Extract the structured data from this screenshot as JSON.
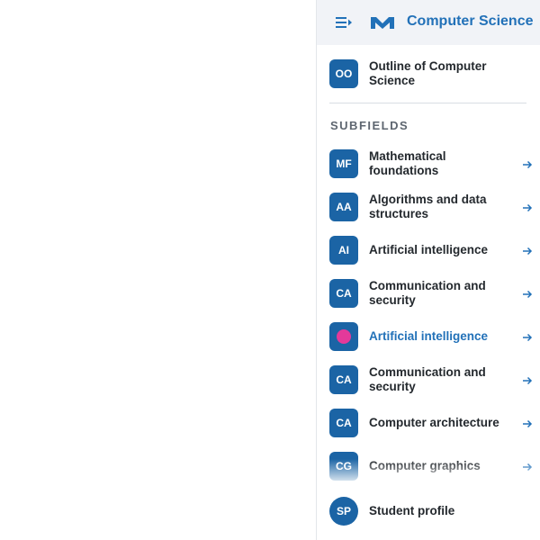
{
  "header": {
    "title": "Computer Science",
    "menu_icon": "collapse-menu-icon",
    "logo_icon": "brand-m-logo-icon"
  },
  "outline": {
    "initials": "OO",
    "label": "Outline of Computer Science"
  },
  "subfields": {
    "title": "SUBFIELDS",
    "items": [
      {
        "initials": "MF",
        "label": "Mathematical foundations",
        "active": false
      },
      {
        "initials": "AA",
        "label": "Algorithms and data structures",
        "active": false
      },
      {
        "initials": "AI",
        "label": "Artificial intelligence",
        "active": false
      },
      {
        "initials": "CA",
        "label": "Communication and security",
        "active": false
      },
      {
        "initials": "",
        "label": "Artificial intelligence",
        "active": true
      },
      {
        "initials": "CA",
        "label": "Communication and security",
        "active": false
      },
      {
        "initials": "CA",
        "label": "Computer architecture",
        "active": false
      },
      {
        "initials": "CG",
        "label": "Computer graphics",
        "active": false
      }
    ],
    "arrow_icon": "arrow-right-icon"
  },
  "profile": {
    "initials": "SP",
    "label": "Student profile"
  },
  "colors": {
    "accent": "#2271b8",
    "avatar": "#1b64a5",
    "active_dot": "#e4399a",
    "header_bg": "#f1f3f7"
  }
}
